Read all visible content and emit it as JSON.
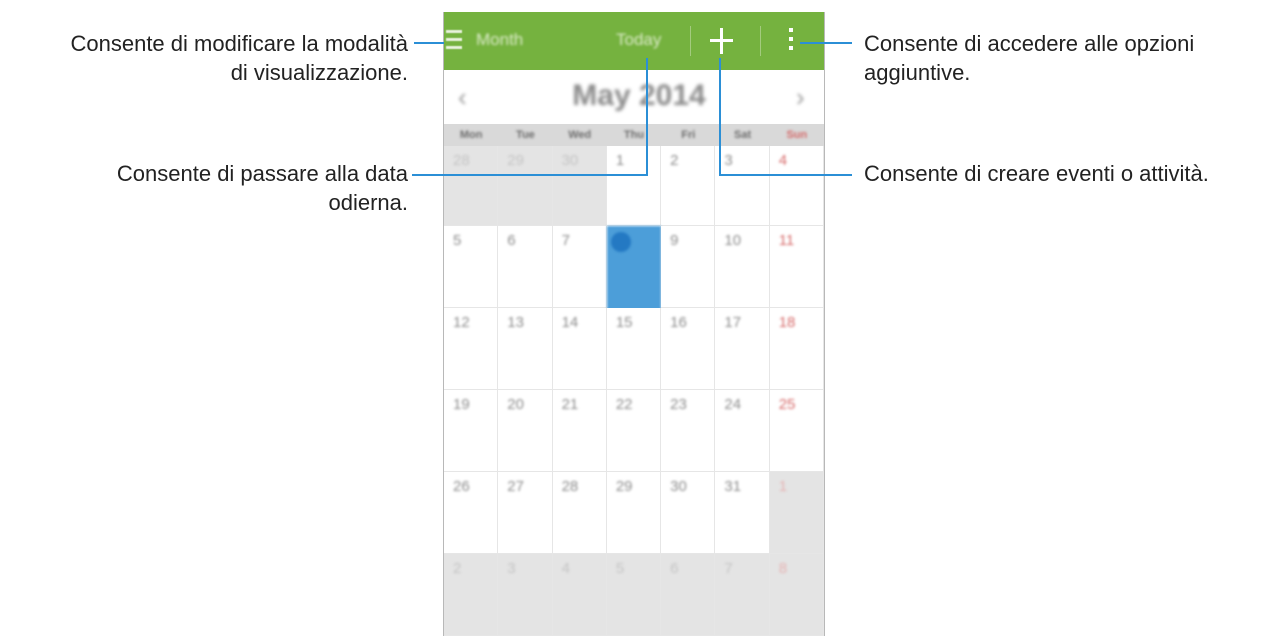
{
  "calendar": {
    "appbar": {
      "view_label": "Month",
      "today_label": "Today"
    },
    "month_title": "May 2014",
    "nav": {
      "prev": "‹",
      "next": "›"
    },
    "weekdays": [
      "Mon",
      "Tue",
      "Wed",
      "Thu",
      "Fri",
      "Sat",
      "Sun"
    ],
    "weeks": [
      [
        "28",
        "29",
        "30",
        "1",
        "2",
        "3",
        "4"
      ],
      [
        "5",
        "6",
        "7",
        "8",
        "9",
        "10",
        "11"
      ],
      [
        "12",
        "13",
        "14",
        "15",
        "16",
        "17",
        "18"
      ],
      [
        "19",
        "20",
        "21",
        "22",
        "23",
        "24",
        "25"
      ],
      [
        "26",
        "27",
        "28",
        "29",
        "30",
        "31",
        "1"
      ],
      [
        "2",
        "3",
        "4",
        "5",
        "6",
        "7",
        "8"
      ]
    ],
    "selected_day": "8",
    "colors": {
      "appbar": "#75b23f",
      "selected": "#4c9ed9",
      "sunday": "#d66a6a",
      "callout_line": "#2b8fd6"
    }
  },
  "callouts": {
    "view_mode": "Consente di modificare la modalità di visualizzazione.",
    "view_mode_line1": "Consente di modificare la modalità",
    "view_mode_line2": "di visualizzazione.",
    "today_line1": "Consente di passare alla data",
    "today_line2": "odierna.",
    "more_line1": "Consente di accedere alle opzioni",
    "more_line2": "aggiuntive.",
    "add": "Consente di creare eventi o attività."
  }
}
